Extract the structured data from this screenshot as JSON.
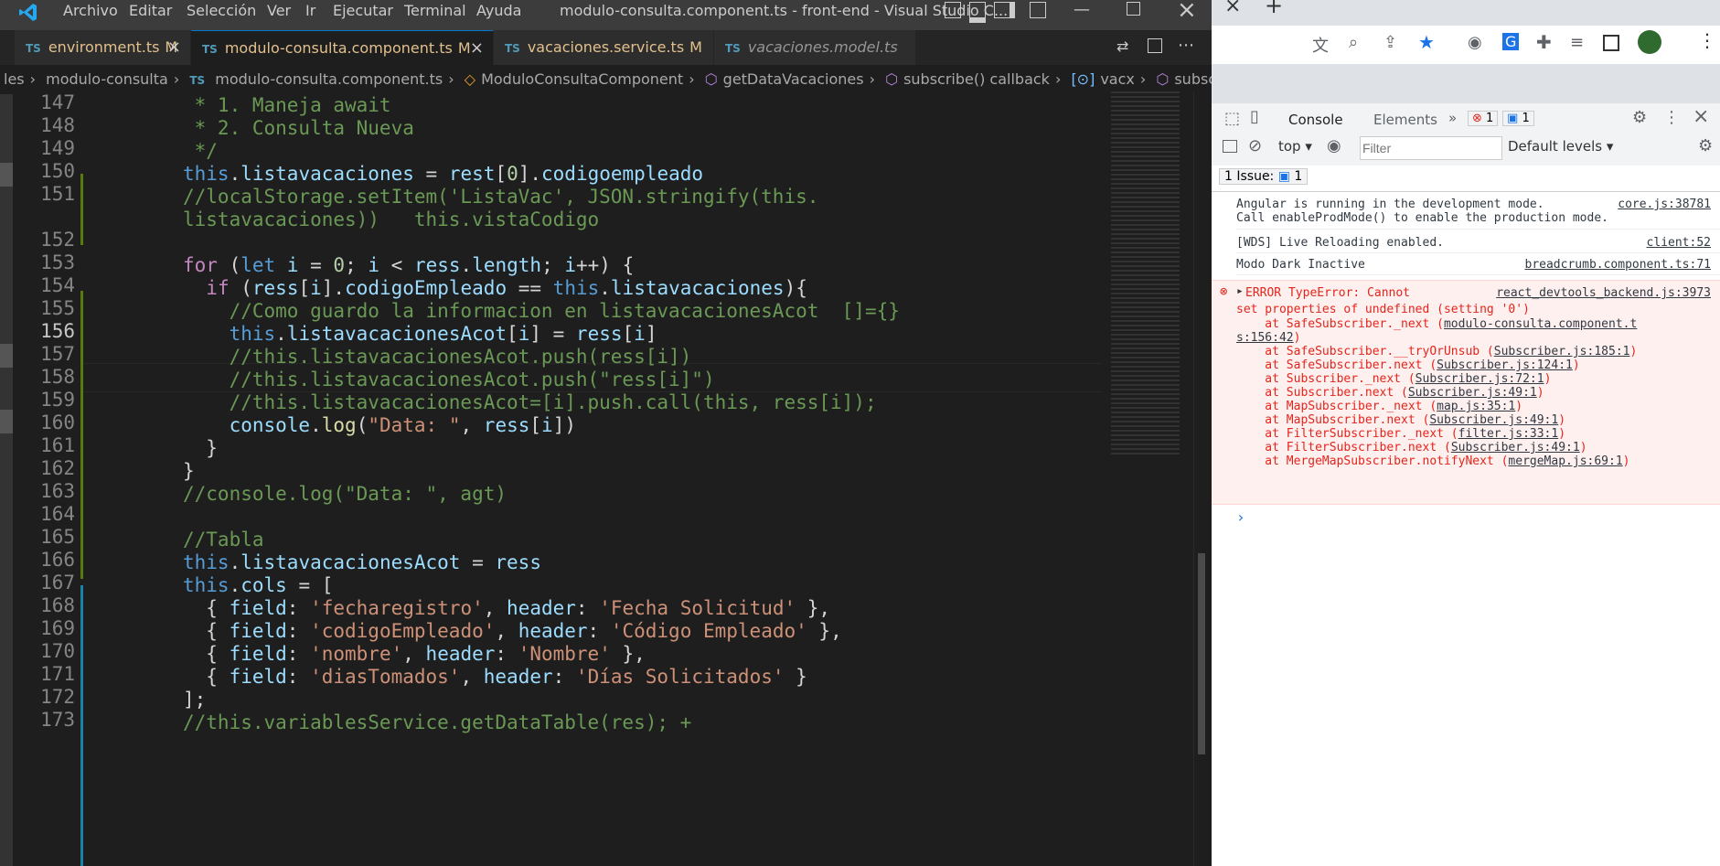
{
  "vscode": {
    "menu": [
      "Archivo",
      "Editar",
      "Selección",
      "Ver",
      "Ir",
      "Ejecutar",
      "Terminal",
      "Ayuda"
    ],
    "window_title": "modulo-consulta.component.ts - front-end - Visual Studio C...",
    "tabs": [
      {
        "icon": "TS",
        "label": "environment.ts",
        "badge": "M",
        "close": "×"
      },
      {
        "icon": "TS",
        "label": "modulo-consulta.component.ts",
        "badge": "M",
        "close": "×"
      },
      {
        "icon": "TS",
        "label": "vacaciones.service.ts",
        "badge": "M"
      },
      {
        "icon": "TS",
        "label": "vacaciones.model.ts"
      }
    ],
    "breadcrumbs": [
      "les",
      "modulo-consulta",
      "TS",
      "modulo-consulta.component.ts",
      "ModuloConsultaComponent",
      "getDataVacaciones",
      "subscribe() callback",
      "vacx",
      "subscribe() callback"
    ],
    "line_numbers": [
      "147",
      "148",
      "149",
      "150",
      "151",
      "",
      "152",
      "153",
      "154",
      "155",
      "156",
      "157",
      "158",
      "159",
      "160",
      "161",
      "162",
      "163",
      "164",
      "165",
      "166",
      "167",
      "168",
      "169",
      "170",
      "171",
      "172",
      "173"
    ],
    "code_lines": [
      " * 1. Maneja await",
      " * 2. Consulta Nueva",
      " */",
      "this.listavacaciones = rest[0].codigoempleado",
      "//localStorage.setItem('ListaVac', JSON.stringify(this.",
      "listavacaciones))   this.vistaCodigo",
      "",
      "for (let i = 0; i < ress.length; i++) {",
      "  if (ress[i].codigoEmpleado == this.listavacaciones){",
      "    //Como guardo la informacion en listavacacionesAcot  []={}",
      "    this.listavacacionesAcot[i] = ress[i]",
      "    //this.listavacacionesAcot.push(ress[i])",
      "    //this.listavacacionesAcot.push(\"ress[i]\")",
      "    //this.listavacacionesAcot=[i].push.call(this, ress[i]);",
      "    console.log(\"Data: \", ress[i])",
      "  }",
      "}",
      "//console.log(\"Data: \", agt)",
      "",
      "//Tabla",
      "this.listavacacionesAcot = ress",
      "this.cols = [",
      "  { field: 'fecharegistro', header: 'Fecha Solicitud' },",
      "  { field: 'codigoEmpleado', header: 'Código Empleado' },",
      "  { field: 'nombre', header: 'Nombre' },",
      "  { field: 'diasTomados', header: 'Días Solicitados' }",
      "];",
      "//this.variablesService.getDataTable(res); +"
    ]
  },
  "devtools": {
    "tabs": [
      "Console",
      "Elements"
    ],
    "error_count": "1",
    "message_count": "1",
    "context": "top",
    "filter_placeholder": "Filter",
    "levels": "Default levels",
    "issues_label": "1 Issue:",
    "issues_count": "1",
    "messages": [
      {
        "text": "Angular is running in the development mode.\nCall enableProdMode() to enable the production mode.",
        "source": "core.js:38781"
      },
      {
        "text": "[WDS] Live Reloading enabled.",
        "source": "client:52"
      },
      {
        "text": "Modo Dark Inactive",
        "source": "breadcrumb.component.ts:71"
      }
    ],
    "error": {
      "head": "ERROR TypeError: Cannot",
      "source": "react_devtools_backend.js:3973",
      "line2": "set properties of undefined (setting '0')",
      "stack": [
        {
          "at": "    at SafeSubscriber._next (",
          "link": "modulo-consulta.component.t"
        },
        {
          "at": "",
          "link": "s:156:42",
          "tail": ")"
        },
        {
          "at": "    at SafeSubscriber.__tryOrUnsub (",
          "link": "Subscriber.js:185:1",
          "tail": ")"
        },
        {
          "at": "    at SafeSubscriber.next (",
          "link": "Subscriber.js:124:1",
          "tail": ")"
        },
        {
          "at": "    at Subscriber._next (",
          "link": "Subscriber.js:72:1",
          "tail": ")"
        },
        {
          "at": "    at Subscriber.next (",
          "link": "Subscriber.js:49:1",
          "tail": ")"
        },
        {
          "at": "    at MapSubscriber._next (",
          "link": "map.js:35:1",
          "tail": ")"
        },
        {
          "at": "    at MapSubscriber.next (",
          "link": "Subscriber.js:49:1",
          "tail": ")"
        },
        {
          "at": "    at FilterSubscriber._next (",
          "link": "filter.js:33:1",
          "tail": ")"
        },
        {
          "at": "    at FilterSubscriber.next (",
          "link": "Subscriber.js:49:1",
          "tail": ")"
        },
        {
          "at": "    at MergeMapSubscriber.notifyNext (",
          "link": "mergeMap.js:69:1",
          "tail": ")"
        }
      ]
    },
    "prompt": "›"
  },
  "colors": {
    "accent": "#007acc",
    "error": "#e4251b",
    "git_modified": "#587c0c"
  }
}
